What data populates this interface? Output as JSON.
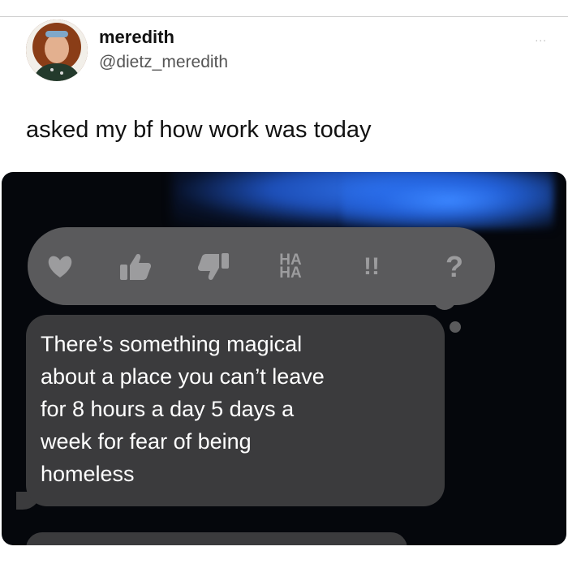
{
  "tweet": {
    "display_name": "meredith",
    "handle": "@dietz_meredith",
    "more_label": "...",
    "text": "asked my bf how work was today"
  },
  "screenshot": {
    "tapbacks": {
      "heart_icon": "heart-icon",
      "like_icon": "thumbs-up-icon",
      "dislike_icon": "thumbs-down-icon",
      "haha_line1": "HA",
      "haha_line2": "HA",
      "emphasize": "!!",
      "question": "?"
    },
    "message_lines": [
      "There’s something magical",
      "about a place you can’t leave",
      "for 8 hours a day 5 days a",
      "week for fear of being",
      "homeless"
    ]
  },
  "colors": {
    "background": "#ffffff",
    "screenshot_background": "#05070c",
    "bubble": "#3b3b3d",
    "tapback_bar": "#5a5a5c",
    "tapback_icon": "#9c9c9e",
    "accent_glow": "#2e6fe6"
  }
}
